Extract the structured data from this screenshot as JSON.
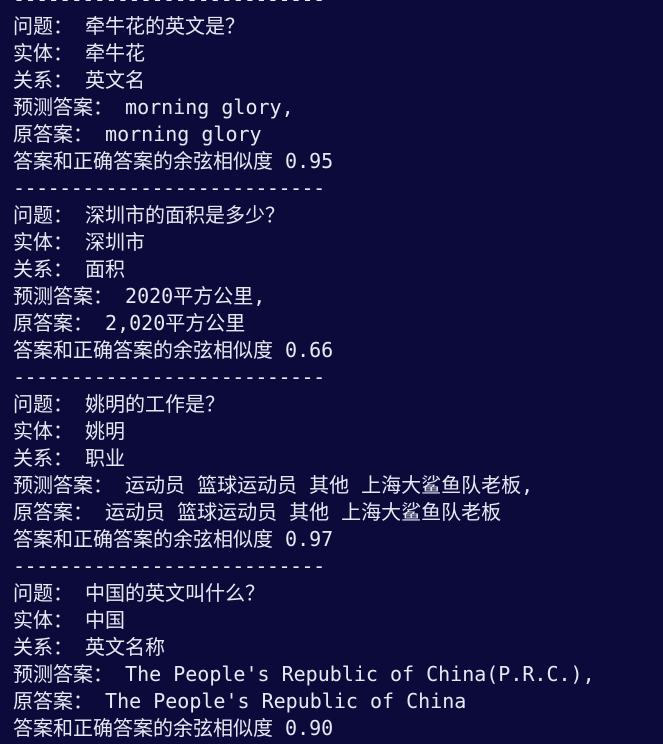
{
  "terminal": {
    "background": "#0b0a3a",
    "foreground": "#e8e8f4",
    "lines": [
      "---------------------------",
      "问题： 牵牛花的英文是？",
      "实体： 牵牛花",
      "关系： 英文名",
      "预测答案： morning glory,",
      "原答案： morning glory",
      "答案和正确答案的余弦相似度 0.95",
      "---------------------------",
      "问题： 深圳市的面积是多少？",
      "实体： 深圳市",
      "关系： 面积",
      "预测答案： 2020平方公里,",
      "原答案： 2,020平方公里",
      "答案和正确答案的余弦相似度 0.66",
      "---------------------------",
      "问题： 姚明的工作是？",
      "实体： 姚明",
      "关系： 职业",
      "预测答案： 运动员 篮球运动员 其他 上海大鲨鱼队老板,",
      "原答案： 运动员 篮球运动员 其他 上海大鲨鱼队老板",
      "答案和正确答案的余弦相似度 0.97",
      "---------------------------",
      "问题： 中国的英文叫什么？",
      "实体： 中国",
      "关系： 英文名称",
      "预测答案： The People's Republic of China(P.R.C.),",
      "原答案： The People's Republic of China",
      "答案和正确答案的余弦相似度 0.90"
    ]
  }
}
